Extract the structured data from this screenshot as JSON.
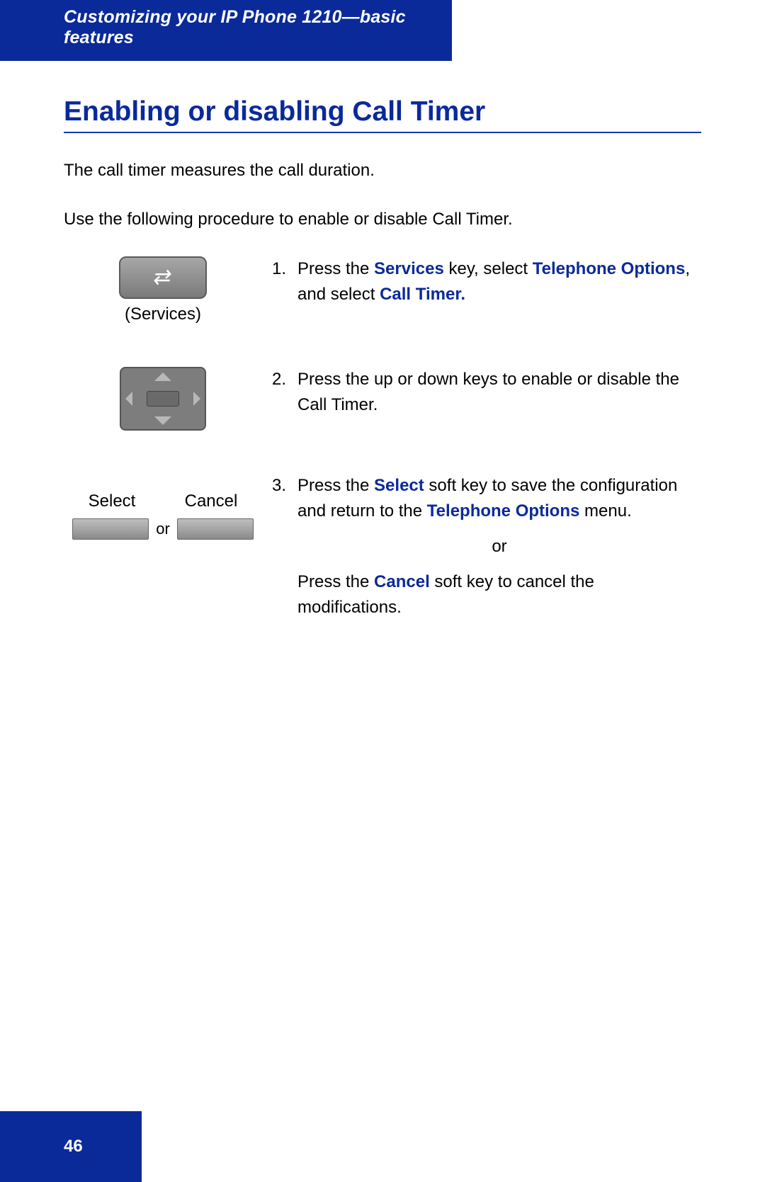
{
  "header": {
    "chapter": "Customizing your IP Phone 1210—basic features"
  },
  "title": "Enabling or disabling Call Timer",
  "intro1": "The call timer measures the call duration.",
  "intro2": "Use the following procedure to enable or disable Call Timer.",
  "step1": {
    "num": "1.",
    "t1": "Press the ",
    "services": "Services",
    "t2": " key, select ",
    "telopts": "Telephone Options",
    "t3": ", and select ",
    "calltimer": "Call Timer.",
    "caption": "(Services)"
  },
  "step2": {
    "num": "2.",
    "text": "Press the up or down keys to enable or disable the Call Timer."
  },
  "step3": {
    "num": "3.",
    "a1": "Press the ",
    "select": "Select",
    "a2": " soft key to save the configuration and return to the ",
    "telopts": "Telephone Options",
    "a3": " menu.",
    "or": "or",
    "b1": "Press the ",
    "cancel": "Cancel",
    "b2": " soft key to cancel the modifications.",
    "labelSelect": "Select",
    "labelCancel": "Cancel",
    "labelOr": "or"
  },
  "pageNumber": "46"
}
